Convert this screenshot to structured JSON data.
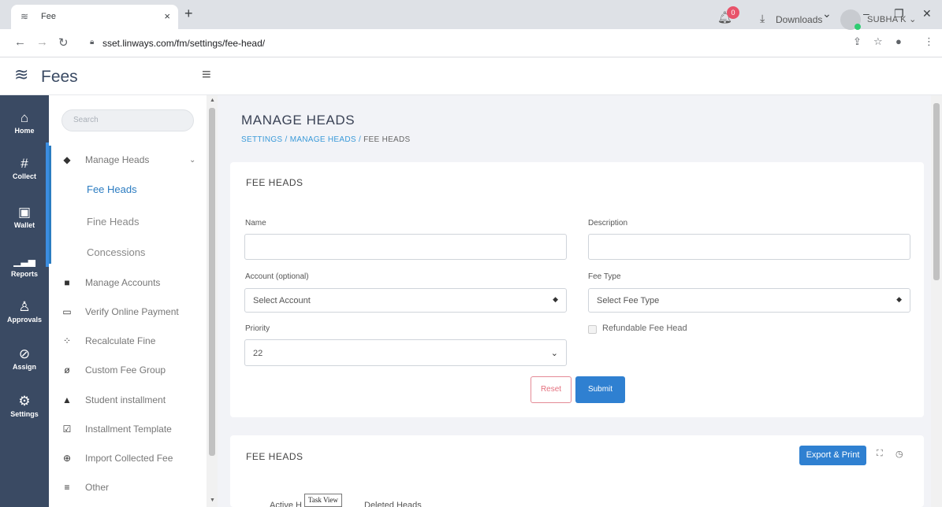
{
  "browser": {
    "tab_title": "Fee",
    "tab_close": "×",
    "new_tab": "+",
    "url": "sset.linways.com/fm/settings/fee-head/",
    "window_controls": [
      "⌄",
      "–",
      "❐",
      "✕"
    ]
  },
  "header": {
    "brand": "Fees",
    "notification_count": "0",
    "downloads_label": "Downloads",
    "user_name": "SUBHA K ⌄"
  },
  "rail": [
    {
      "label": "Home",
      "icon": "home-icon"
    },
    {
      "label": "Collect",
      "icon": "hash-icon"
    },
    {
      "label": "Wallet",
      "icon": "wallet-icon"
    },
    {
      "label": "Reports",
      "icon": "bar-chart-icon"
    },
    {
      "label": "Approvals",
      "icon": "user-check-icon"
    },
    {
      "label": "Assign",
      "icon": "check-circle-icon"
    },
    {
      "label": "Settings",
      "icon": "gear-icon"
    }
  ],
  "subnav": {
    "search_placeholder": "Search",
    "manage_heads": "Manage Heads",
    "sub_items": [
      "Fee Heads",
      "Fine Heads",
      "Concessions"
    ],
    "items": [
      {
        "label": "Manage Accounts",
        "icon": "book-icon"
      },
      {
        "label": "Verify Online Payment",
        "icon": "credit-card-icon"
      },
      {
        "label": "Recalculate Fine",
        "icon": "spinner-icon"
      },
      {
        "label": "Custom Fee Group",
        "icon": "circle-slash-icon"
      },
      {
        "label": "Student installment",
        "icon": "user-icon"
      },
      {
        "label": "Installment Template",
        "icon": "check-square-icon"
      },
      {
        "label": "Import Collected Fee",
        "icon": "plus-circle-icon"
      },
      {
        "label": "Other",
        "icon": "menu-icon"
      }
    ]
  },
  "page": {
    "title": "MANAGE HEADS",
    "breadcrumb": [
      "SETTINGS",
      "MANAGE HEADS",
      "FEE HEADS"
    ],
    "breadcrumb_sep": "/"
  },
  "form": {
    "card_title": "FEE HEADS",
    "name_label": "Name",
    "name_value": "",
    "description_label": "Description",
    "description_value": "",
    "account_label": "Account (optional)",
    "account_value": "Select Account",
    "fee_type_label": "Fee Type",
    "fee_type_value": "Select Fee Type",
    "priority_label": "Priority",
    "priority_value": "22",
    "refundable_label": "Refundable Fee Head",
    "reset_label": "Reset",
    "submit_label": "Submit"
  },
  "list": {
    "card_title": "FEE HEADS",
    "export_label": "Export & Print",
    "tabs": [
      "Active H",
      "Deleted Heads"
    ],
    "tooltip": "Task View"
  },
  "colors": {
    "rail": "#3a4a63",
    "accent": "#2f80d1",
    "reset": "#e4707e"
  }
}
